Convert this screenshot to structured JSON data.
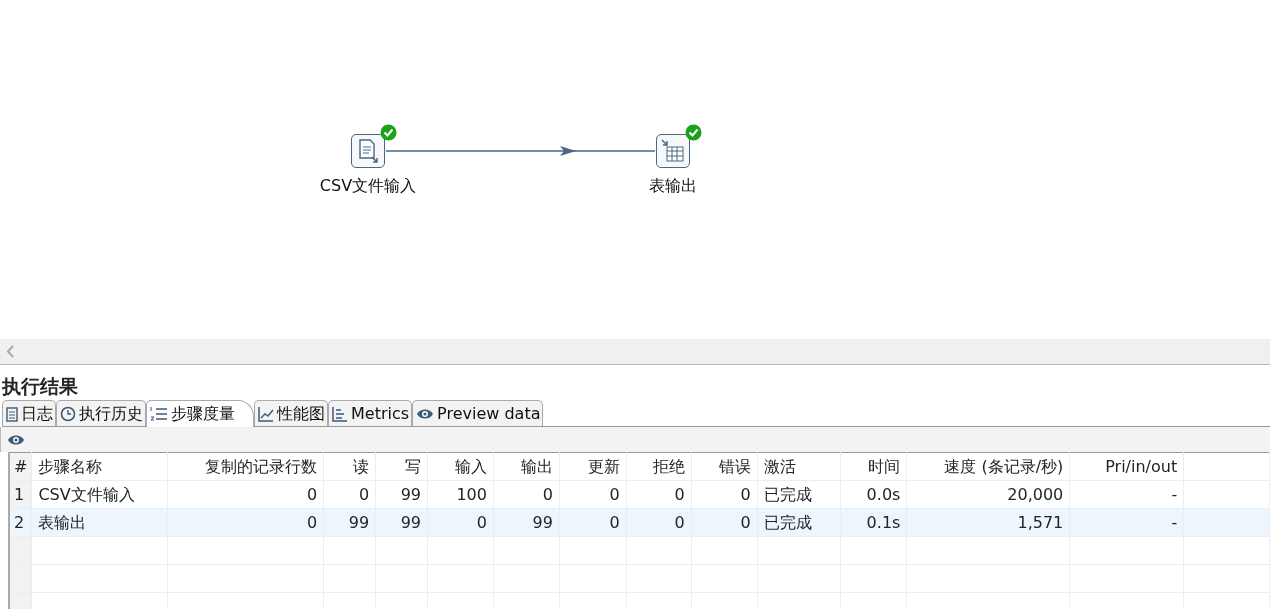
{
  "canvas": {
    "steps": [
      {
        "label": "CSV文件输入",
        "finished": true
      },
      {
        "label": "表输出",
        "finished": true
      }
    ]
  },
  "panel": {
    "title": "执行结果",
    "tabs": [
      {
        "label": "日志",
        "selected": false
      },
      {
        "label": "执行历史",
        "selected": false
      },
      {
        "label": "步骤度量",
        "selected": true
      },
      {
        "label": "性能图",
        "selected": false
      },
      {
        "label": "Metrics",
        "selected": false
      },
      {
        "label": "Preview data",
        "selected": false
      }
    ],
    "table": {
      "columns": [
        {
          "label": "#",
          "kind": "text"
        },
        {
          "label": "步骤名称",
          "kind": "text"
        },
        {
          "label": "复制的记录行数",
          "kind": "number"
        },
        {
          "label": "读",
          "kind": "number"
        },
        {
          "label": "写",
          "kind": "number"
        },
        {
          "label": "输入",
          "kind": "number"
        },
        {
          "label": "输出",
          "kind": "number"
        },
        {
          "label": "更新",
          "kind": "number"
        },
        {
          "label": "拒绝",
          "kind": "number"
        },
        {
          "label": "错误",
          "kind": "number"
        },
        {
          "label": "激活",
          "kind": "text"
        },
        {
          "label": "时间",
          "kind": "number"
        },
        {
          "label": "速度 (条记录/秒)",
          "kind": "number"
        },
        {
          "label": "Pri/in/out",
          "kind": "number"
        }
      ],
      "rows": [
        [
          "1",
          "CSV文件输入",
          "0",
          "0",
          "99",
          "100",
          "0",
          "0",
          "0",
          "0",
          "已完成",
          "0.0s",
          "20,000",
          "-"
        ],
        [
          "2",
          "表输出",
          "0",
          "99",
          "99",
          "0",
          "99",
          "0",
          "0",
          "0",
          "已完成",
          "0.1s",
          "1,571",
          "-"
        ]
      ]
    }
  }
}
